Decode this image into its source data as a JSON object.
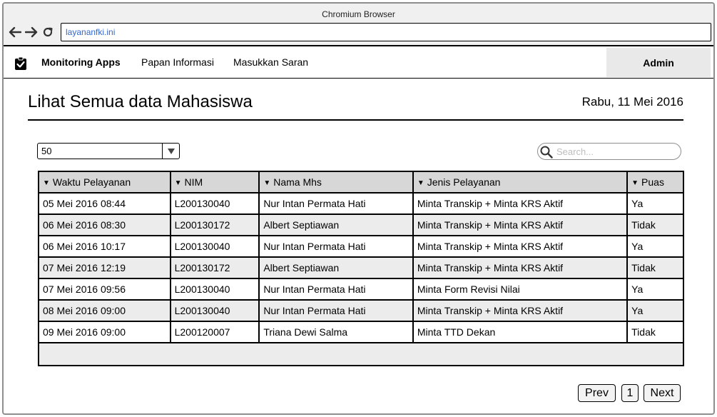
{
  "browser": {
    "title": "Chromium Browser",
    "url": "layananfki.ini",
    "icons": [
      "back-arrow-icon",
      "forward-arrow-icon",
      "reload-icon"
    ]
  },
  "nav": {
    "brand": "Monitoring Apps",
    "links": [
      "Papan Informasi",
      "Masukkan Saran"
    ],
    "user": "Admin"
  },
  "page": {
    "title": "Lihat Semua data Mahasiswa",
    "date": "Rabu, 11 Mei 2016"
  },
  "controls": {
    "page_size": "50",
    "search_placeholder": "Search..."
  },
  "table": {
    "columns": [
      "Waktu Pelayanan",
      "NIM",
      "Nama Mhs",
      "Jenis Pelayanan",
      "Puas"
    ],
    "rows": [
      [
        "05 Mei 2016 08:44",
        "L200130040",
        "Nur Intan Permata Hati",
        "Minta Transkip + Minta KRS Aktif",
        "Ya"
      ],
      [
        "06 Mei 2016 08:30",
        "L200130172",
        "Albert Septiawan",
        "Minta Transkip + Minta KRS Aktif",
        "Tidak"
      ],
      [
        "06 Mei 2016 10:17",
        "L200130040",
        "Nur Intan Permata Hati",
        "Minta Transkip + Minta KRS Aktif",
        "Ya"
      ],
      [
        "07 Mei 2016 12:19",
        "L200130172",
        "Albert Septiawan",
        "Minta Transkip + Minta KRS Aktif",
        "Tidak"
      ],
      [
        "07 Mei 2016 09:56",
        "L200130040",
        "Nur Intan Permata Hati",
        "Minta Form Revisi Nilai",
        "Ya"
      ],
      [
        "08 Mei 2016 09:00",
        "L200130040",
        "Nur Intan Permata Hati",
        "Minta Transkip + Minta KRS Aktif",
        "Ya"
      ],
      [
        "09 Mei 2016 09:00",
        "L200120007",
        "Triana Dewi Salma",
        "Minta TTD Dekan",
        "Tidak"
      ]
    ]
  },
  "pagination": {
    "prev": "Prev",
    "page": "1",
    "next": "Next"
  },
  "colors": {
    "url_text": "#3366cc",
    "header_bg": "#d7d7d7",
    "stripe_bg": "#ececec",
    "admin_bg": "#e9e9e9"
  }
}
